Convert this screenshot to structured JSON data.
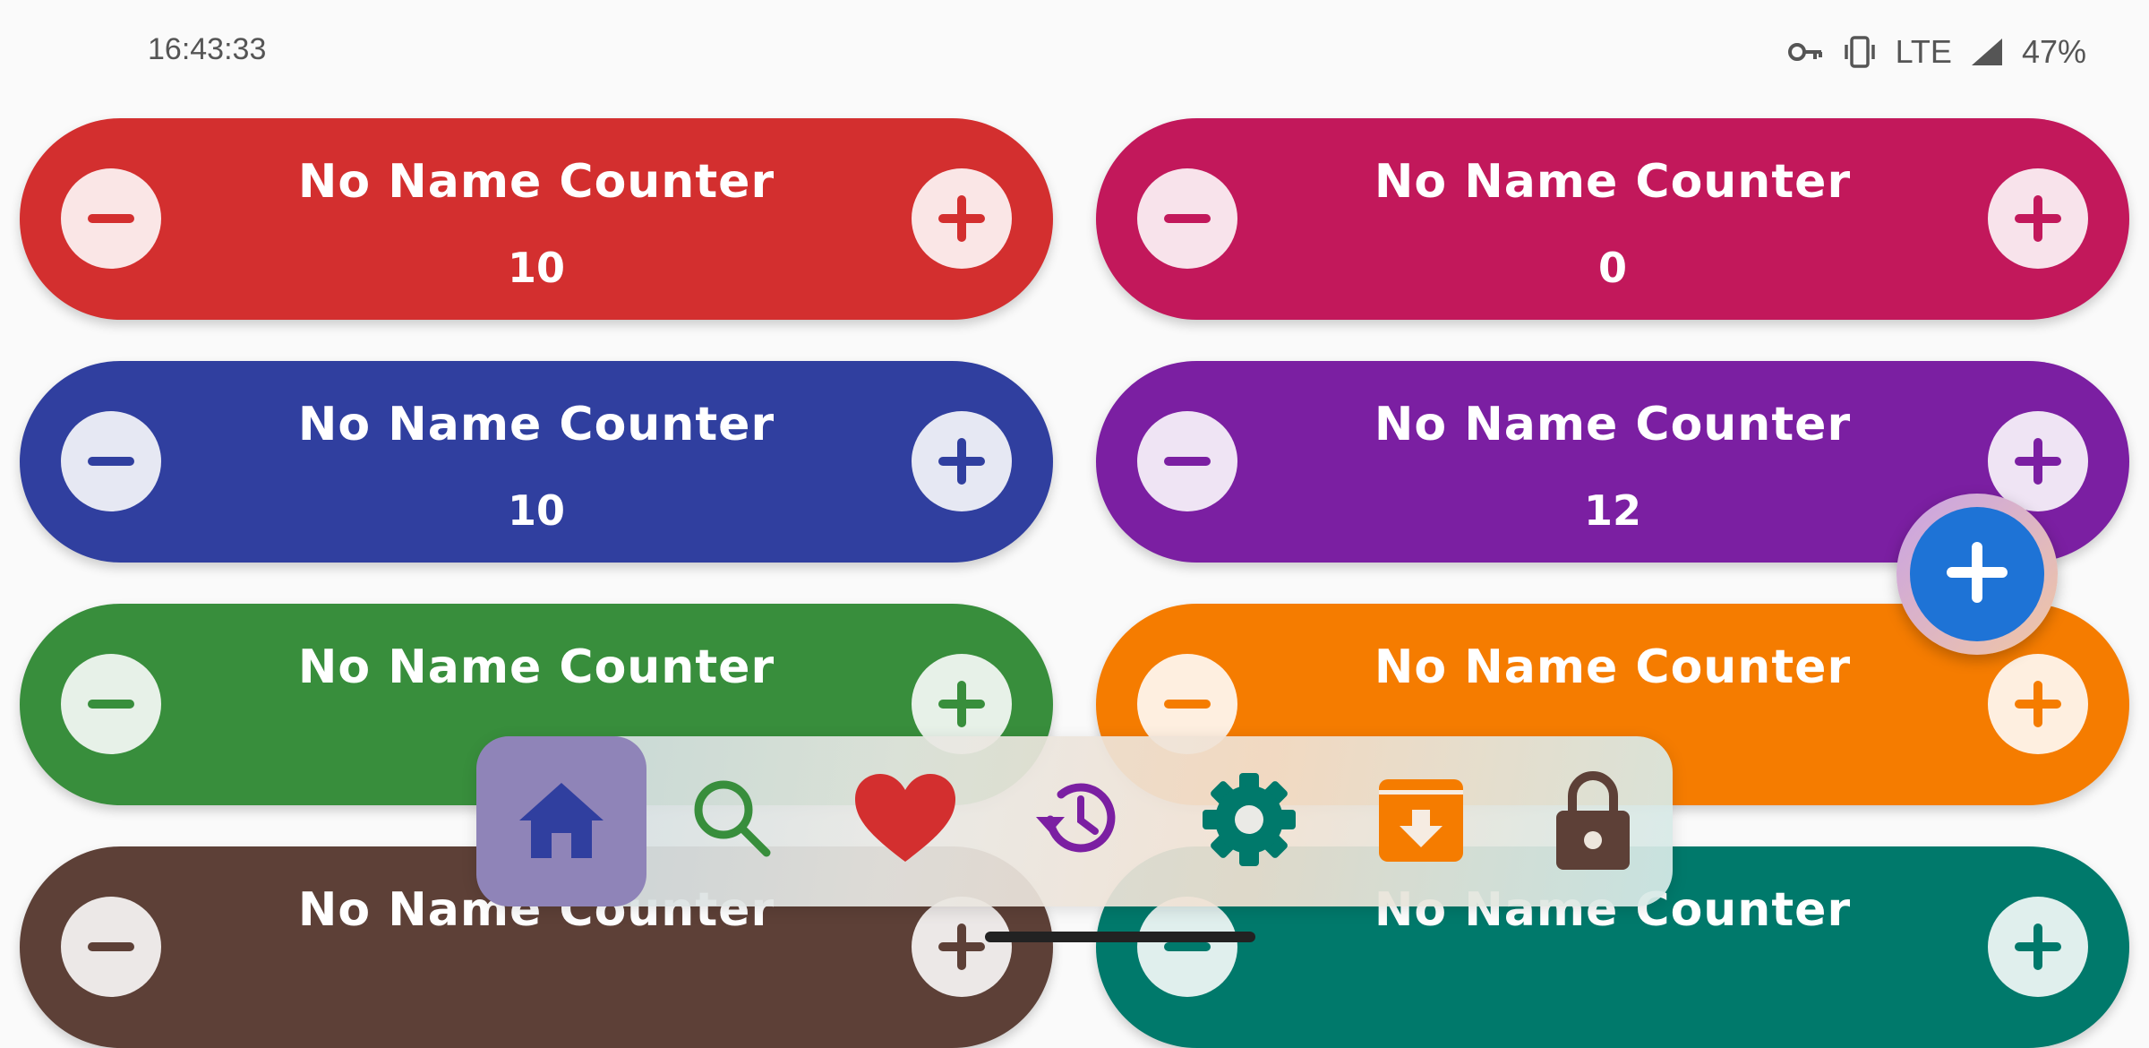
{
  "status_bar": {
    "time": "16:43:33",
    "network": "LTE",
    "battery": "47%",
    "icons": [
      "vpn-key-icon",
      "vibrate-icon",
      "signal-icon"
    ]
  },
  "counters": [
    {
      "title": "No Name Counter",
      "value": "10",
      "color": "#d32f2f"
    },
    {
      "title": "No Name Counter",
      "value": "0",
      "color": "#c2185b"
    },
    {
      "title": "No Name Counter",
      "value": "10",
      "color": "#303f9f"
    },
    {
      "title": "No Name Counter",
      "value": "12",
      "color": "#7b1fa2"
    },
    {
      "title": "No Name Counter",
      "value": "",
      "color": "#388e3c"
    },
    {
      "title": "No Name Counter",
      "value": "",
      "color": "#f57c00"
    },
    {
      "title": "No Name Counter",
      "value": "",
      "color": "#5d4037"
    },
    {
      "title": "No Name Counter",
      "value": "",
      "color": "#00796b"
    }
  ],
  "fab": {
    "icon": "add-icon",
    "color": "#1e73d6"
  },
  "nav": {
    "selected": "home",
    "items": [
      {
        "id": "home",
        "icon": "home-icon",
        "color": "#303f9f"
      },
      {
        "id": "search",
        "icon": "search-icon",
        "color": "#388e3c"
      },
      {
        "id": "favorites",
        "icon": "heart-icon",
        "color": "#d32f2f"
      },
      {
        "id": "history",
        "icon": "history-icon",
        "color": "#7b1fa2"
      },
      {
        "id": "settings",
        "icon": "gear-icon",
        "color": "#00796b"
      },
      {
        "id": "archive",
        "icon": "archive-icon",
        "color": "#f57c00"
      },
      {
        "id": "lock",
        "icon": "lock-icon",
        "color": "#5d4037"
      }
    ]
  }
}
